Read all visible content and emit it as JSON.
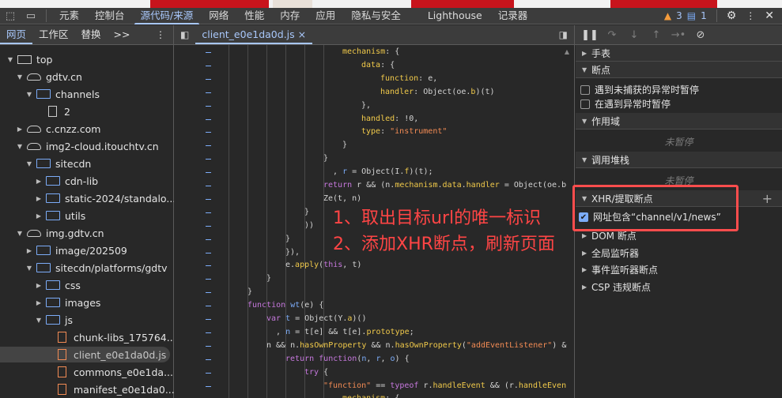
{
  "toolbar": {
    "tabs": [
      "元素",
      "控制台",
      "源代码/来源",
      "网络",
      "性能",
      "内存",
      "应用",
      "隐私与安全",
      "Lighthouse",
      "记录器"
    ],
    "active_tab": "源代码/来源",
    "warnings": "3",
    "messages": "1"
  },
  "left_panel": {
    "tabs": [
      "网页",
      "工作区",
      "替换"
    ],
    "more": ">>",
    "tree": [
      {
        "label": "top",
        "depth": 0,
        "icon": "frame",
        "open": true
      },
      {
        "label": "gdtv.cn",
        "depth": 1,
        "icon": "cloud",
        "open": true
      },
      {
        "label": "channels",
        "depth": 2,
        "icon": "folder",
        "open": true
      },
      {
        "label": "2",
        "depth": 3,
        "icon": "document"
      },
      {
        "label": "c.cnzz.com",
        "depth": 1,
        "icon": "cloud",
        "open": false
      },
      {
        "label": "img2-cloud.itouchtv.cn",
        "depth": 1,
        "icon": "cloud",
        "open": true
      },
      {
        "label": "sitecdn",
        "depth": 2,
        "icon": "folder",
        "open": true
      },
      {
        "label": "cdn-lib",
        "depth": 3,
        "icon": "folder",
        "open": false
      },
      {
        "label": "static-2024/standalo...",
        "depth": 3,
        "icon": "folder",
        "open": false
      },
      {
        "label": "utils",
        "depth": 3,
        "icon": "folder",
        "open": false
      },
      {
        "label": "img.gdtv.cn",
        "depth": 1,
        "icon": "cloud",
        "open": true
      },
      {
        "label": "image/202509",
        "depth": 2,
        "icon": "folder",
        "open": false
      },
      {
        "label": "sitecdn/platforms/gdtv",
        "depth": 2,
        "icon": "folder",
        "open": true
      },
      {
        "label": "css",
        "depth": 3,
        "icon": "folder",
        "open": false
      },
      {
        "label": "images",
        "depth": 3,
        "icon": "folder",
        "open": false
      },
      {
        "label": "js",
        "depth": 3,
        "icon": "folder",
        "open": true
      },
      {
        "label": "chunk-libs_175764...",
        "depth": 4,
        "icon": "js-file"
      },
      {
        "label": "client_e0e1da0d.js",
        "depth": 4,
        "icon": "js-file",
        "selected": true
      },
      {
        "label": "commons_e0e1da...",
        "depth": 4,
        "icon": "js-file"
      },
      {
        "label": "manifest_e0e1da0...",
        "depth": 4,
        "icon": "js-file"
      }
    ]
  },
  "editor": {
    "file_tab": "client_e0e1da0d.js",
    "lines": [
      {
        "i": 5,
        "t": [
          [
            "p",
            "mechanism"
          ],
          [
            "n",
            ": {"
          ]
        ]
      },
      {
        "i": 6,
        "t": [
          [
            "p",
            "data"
          ],
          [
            "n",
            ": {"
          ]
        ]
      },
      {
        "i": 7,
        "t": [
          [
            "p",
            "function"
          ],
          [
            "n",
            ": e,"
          ]
        ]
      },
      {
        "i": 7,
        "t": [
          [
            "p",
            "handler"
          ],
          [
            "n",
            ": Object(oe."
          ],
          [
            "p",
            "b"
          ],
          [
            "n",
            ")(t)"
          ]
        ]
      },
      {
        "i": 6,
        "t": [
          [
            "n",
            "},"
          ]
        ]
      },
      {
        "i": 6,
        "t": [
          [
            "p",
            "handled"
          ],
          [
            "n",
            ": !0,"
          ]
        ]
      },
      {
        "i": 6,
        "t": [
          [
            "p",
            "type"
          ],
          [
            "n",
            ": "
          ],
          [
            "s",
            "\"instrument\""
          ]
        ]
      },
      {
        "i": 5,
        "t": [
          [
            "n",
            "}"
          ]
        ]
      },
      {
        "i": 4,
        "t": [
          [
            "n",
            "}"
          ]
        ]
      },
      {
        "i": 4,
        "t": [
          [
            "n",
            "  , "
          ],
          [
            "v",
            "r"
          ],
          [
            "n",
            " = Object(I."
          ],
          [
            "p",
            "f"
          ],
          [
            "n",
            ")(t);"
          ]
        ]
      },
      {
        "i": 4,
        "t": [
          [
            "k",
            "return"
          ],
          [
            "n",
            " r && (n."
          ],
          [
            "p",
            "mechanism"
          ],
          [
            "n",
            "."
          ],
          [
            "p",
            "data"
          ],
          [
            "n",
            "."
          ],
          [
            "p",
            "handler"
          ],
          [
            "n",
            " = Object(oe.b"
          ]
        ]
      },
      {
        "i": 4,
        "t": [
          [
            "n",
            "Ze(t, n)"
          ]
        ]
      },
      {
        "i": 3,
        "t": [
          [
            "n",
            "}"
          ]
        ]
      },
      {
        "i": 3,
        "t": [
          [
            "n",
            "))"
          ]
        ]
      },
      {
        "i": 2,
        "t": [
          [
            "n",
            "}"
          ]
        ]
      },
      {
        "i": 2,
        "t": [
          [
            "n",
            "}),"
          ]
        ]
      },
      {
        "i": 2,
        "t": [
          [
            "n",
            "e."
          ],
          [
            "p",
            "apply"
          ],
          [
            "n",
            "("
          ],
          [
            "k",
            "this"
          ],
          [
            "n",
            ", t)"
          ]
        ]
      },
      {
        "i": 1,
        "t": [
          [
            "n",
            "}"
          ]
        ]
      },
      {
        "i": 0,
        "t": [
          [
            "n",
            "}"
          ]
        ]
      },
      {
        "i": 0,
        "t": [
          [
            "k",
            "function"
          ],
          [
            "n",
            " "
          ],
          [
            "v",
            "wt"
          ],
          [
            "n",
            "(e) {"
          ]
        ]
      },
      {
        "i": 1,
        "t": [
          [
            "k",
            "var"
          ],
          [
            "n",
            " "
          ],
          [
            "v",
            "t"
          ],
          [
            "n",
            " = Object(Y."
          ],
          [
            "p",
            "a"
          ],
          [
            "n",
            ")()"
          ]
        ]
      },
      {
        "i": 1,
        "t": [
          [
            "n",
            "  , "
          ],
          [
            "v",
            "n"
          ],
          [
            "n",
            " = t[e] && t[e]."
          ],
          [
            "p",
            "prototype"
          ],
          [
            "n",
            ";"
          ]
        ]
      },
      {
        "i": 1,
        "t": [
          [
            "n",
            "n && n."
          ],
          [
            "p",
            "hasOwnProperty"
          ],
          [
            "n",
            " && n."
          ],
          [
            "p",
            "hasOwnProperty"
          ],
          [
            "n",
            "("
          ],
          [
            "s",
            "\"addEventListener\""
          ],
          [
            "n",
            ") &"
          ]
        ]
      },
      {
        "i": 2,
        "t": [
          [
            "k",
            "return"
          ],
          [
            "n",
            " "
          ],
          [
            "k",
            "function"
          ],
          [
            "n",
            "("
          ],
          [
            "v",
            "n"
          ],
          [
            "n",
            ", "
          ],
          [
            "v",
            "r"
          ],
          [
            "n",
            ", "
          ],
          [
            "v",
            "o"
          ],
          [
            "n",
            ") {"
          ]
        ]
      },
      {
        "i": 3,
        "t": [
          [
            "k",
            "try"
          ],
          [
            "n",
            " {"
          ]
        ]
      },
      {
        "i": 4,
        "t": [
          [
            "s",
            "\"function\""
          ],
          [
            "n",
            " == "
          ],
          [
            "k",
            "typeof"
          ],
          [
            "n",
            " r."
          ],
          [
            "p",
            "handleEvent"
          ],
          [
            "n",
            " && (r."
          ],
          [
            "p",
            "handleEven"
          ]
        ]
      },
      {
        "i": 5,
        "t": [
          [
            "p",
            "mechanism"
          ],
          [
            "n",
            ": {"
          ]
        ]
      }
    ]
  },
  "right_panel": {
    "watch": "手表",
    "breakpoints": "断点",
    "pause_uncaught": "遇到未捕获的异常时暂停",
    "pause_caught": "在遇到异常时暂停",
    "scope": "作用域",
    "not_paused_1": "未暂停",
    "call_stack": "调用堆栈",
    "not_paused_2": "未暂停",
    "xhr": "XHR/提取断点",
    "xhr_add": "+",
    "xhr_item": "网址包含“channel/v1/news”",
    "xhr_item_checked": true,
    "dom": "DOM 断点",
    "global": "全局监听器",
    "event": "事件监听器断点",
    "csp": "CSP 违规断点"
  },
  "annotations": {
    "step1": "1、取出目标url的唯一标识",
    "step2": "2、添加XHR断点，刷新页面",
    "color": "#ff4545"
  }
}
